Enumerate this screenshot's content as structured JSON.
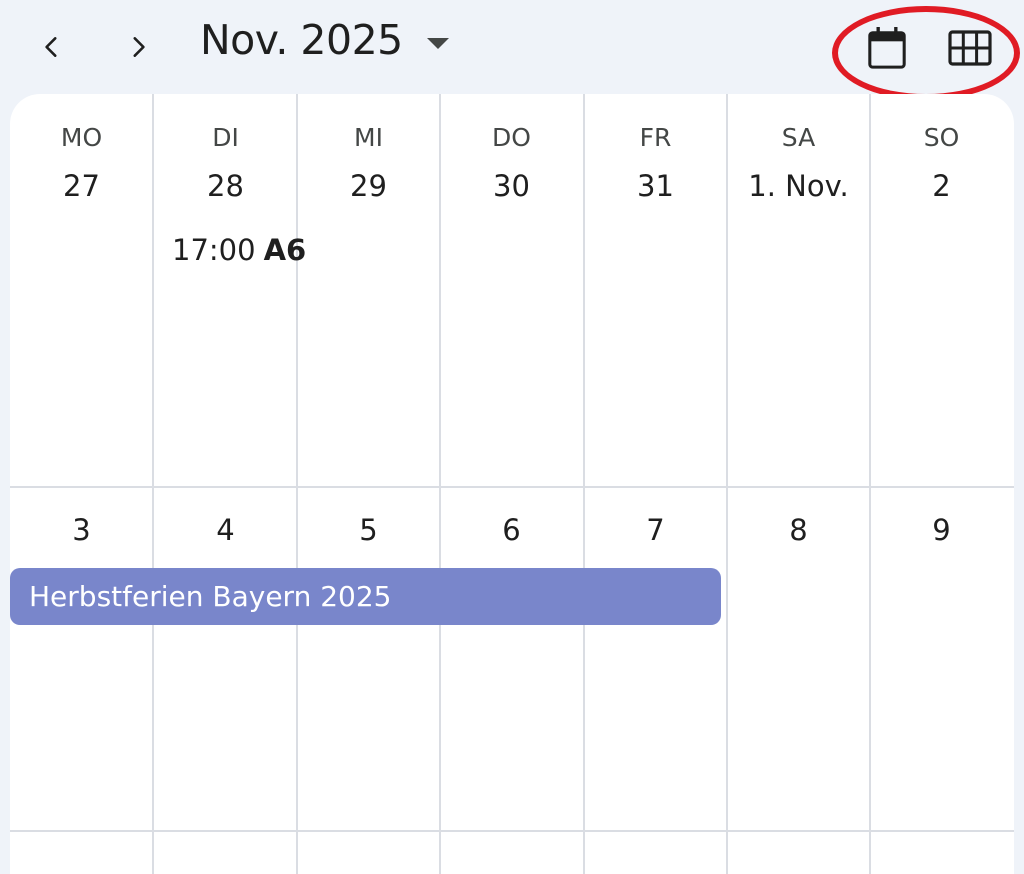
{
  "header": {
    "prev_icon": "chevron-left-icon",
    "next_icon": "chevron-right-icon",
    "month_title": "Nov. 2025",
    "dropdown_icon": "caret-down-icon",
    "day_view_icon": "calendar-day-icon",
    "month_view_icon": "grid-month-icon",
    "highlight_color": "#e01b24"
  },
  "weekdays": [
    "MO",
    "DI",
    "MI",
    "DO",
    "FR",
    "SA",
    "SO"
  ],
  "week1": [
    "27",
    "28",
    "29",
    "30",
    "31",
    "1. Nov.",
    "2"
  ],
  "week2": [
    "3",
    "4",
    "5",
    "6",
    "7",
    "8",
    "9"
  ],
  "events": {
    "timed": {
      "time": "17:00",
      "title": "A6"
    },
    "allday": {
      "title": "Herbstferien Bayern 2025",
      "color": "#7986cb"
    }
  }
}
